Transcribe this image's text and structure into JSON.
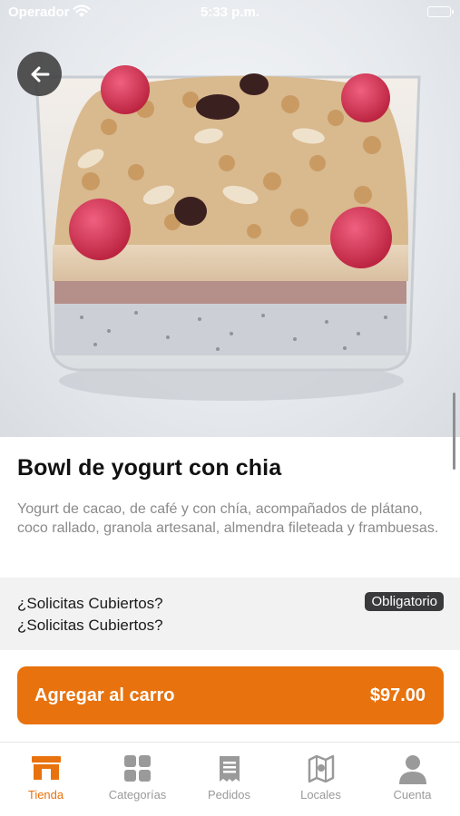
{
  "status_bar": {
    "carrier": "Operador",
    "time": "5:33 p.m."
  },
  "product": {
    "title": "Bowl de yogurt con chia",
    "description": "Yogurt de cacao, de café y con chía, acompañados de plátano, coco rallado, granola artesanal, almendra fileteada y frambuesas."
  },
  "options": {
    "line1": "¿Solicitas Cubiertos?",
    "line2": "¿Solicitas Cubiertos?",
    "badge": "Obligatorio"
  },
  "cart_button": {
    "label": "Agregar al carro",
    "price": "$97.00"
  },
  "tabs": [
    {
      "label": "Tienda",
      "icon": "store-icon",
      "active": true
    },
    {
      "label": "Categorías",
      "icon": "grid-icon",
      "active": false
    },
    {
      "label": "Pedidos",
      "icon": "receipt-icon",
      "active": false
    },
    {
      "label": "Locales",
      "icon": "map-icon",
      "active": false
    },
    {
      "label": "Cuenta",
      "icon": "person-icon",
      "active": false
    }
  ],
  "colors": {
    "accent": "#e8720d",
    "badge": "#3a3a3c",
    "inactive_tab": "#9a9a9a"
  }
}
